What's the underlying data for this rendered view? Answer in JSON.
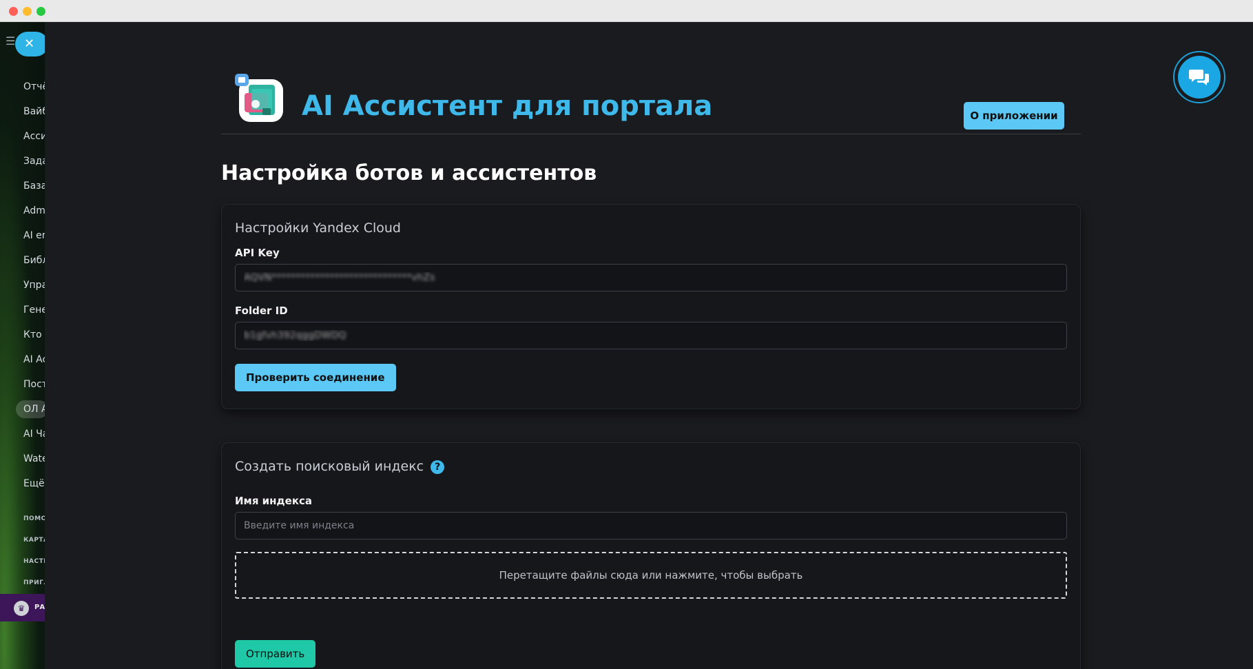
{
  "sidebar": {
    "menu_icon": "hamburger-icon",
    "close_icon": "close-icon",
    "close_glyph": "✕",
    "items": [
      {
        "label": "Отчё"
      },
      {
        "label": "Вайб"
      },
      {
        "label": "Асси"
      },
      {
        "label": "Зада"
      },
      {
        "label": "База"
      },
      {
        "label": "Adm"
      },
      {
        "label": "AI er"
      },
      {
        "label": "Библ"
      },
      {
        "label": "Упра"
      },
      {
        "label": "Гене"
      },
      {
        "label": "Кто в"
      },
      {
        "label": "AI Ac"
      },
      {
        "label": "Пост"
      },
      {
        "label": "ОЛ А"
      },
      {
        "label": "AI Ча"
      },
      {
        "label": "Wate"
      },
      {
        "label": "Ещё"
      }
    ],
    "small_links": [
      "ПОМО",
      "КАРТА",
      "НАСТР",
      "ПРИГЛ"
    ],
    "bottom_label": "РА"
  },
  "header": {
    "title": "AI Ассистент для портала",
    "about_button": "О приложении"
  },
  "page": {
    "section_title": "Настройка ботов и ассистентов"
  },
  "yandex_card": {
    "title": "Настройки Yandex Cloud",
    "api_key_label": "API Key",
    "api_key_value": "AQVN*****************************vhZs",
    "folder_id_label": "Folder ID",
    "folder_id_value": "b1gfvh392qggDWDQ",
    "check_button": "Проверить соединение"
  },
  "index_card": {
    "title": "Создать поисковый индекс",
    "help_glyph": "?",
    "name_label": "Имя индекса",
    "name_placeholder": "Введите имя индекса",
    "dropzone_text": "Перетащите файлы сюда или нажмите, чтобы выбрать",
    "submit_button": "Отправить"
  },
  "colors": {
    "accent": "#3fb8ea",
    "button_primary": "#5bc8f5",
    "button_teal": "#1fc9a7",
    "background": "#1a1b1e",
    "card": "#16171a"
  }
}
